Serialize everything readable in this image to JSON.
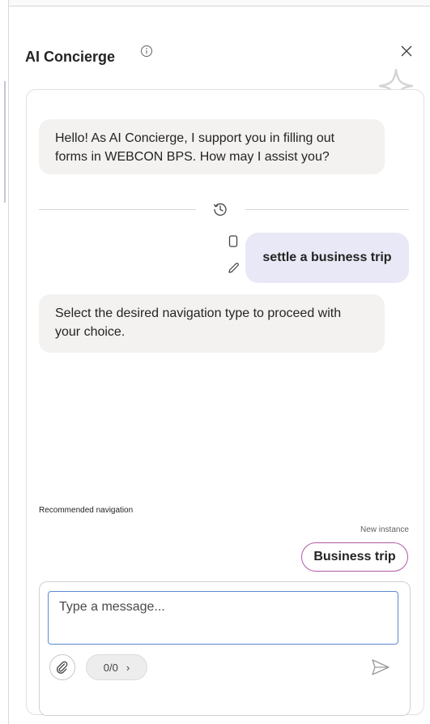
{
  "header": {
    "title": "AI Concierge",
    "info_icon": "info-icon",
    "close_icon": "close-icon",
    "sparkle_icon": "sparkle-icon"
  },
  "conversation": {
    "greeting": "Hello! As AI Concierge, I support you in filling out forms in WEBCON BPS. How may I assist you?",
    "history_icon": "history-icon",
    "user_message": "settle a business trip",
    "copy_icon": "copy-icon",
    "edit_icon": "edit-icon",
    "bot_reply": "Select the desired navigation type to proceed with your choice."
  },
  "recommendation": {
    "label": "Recommended navigation",
    "type_label": "New instance",
    "option_label": "Business trip",
    "accent_color": "#b25aa6"
  },
  "composer": {
    "placeholder": "Type a message...",
    "value": "",
    "counter": "0/0",
    "counter_chevron": "›",
    "attach_icon": "paperclip-icon",
    "send_icon": "send-icon"
  },
  "colors": {
    "user_bubble": "#e8e8f6",
    "bot_bubble": "#f3f2f1",
    "input_focus": "#5b8ad0"
  }
}
